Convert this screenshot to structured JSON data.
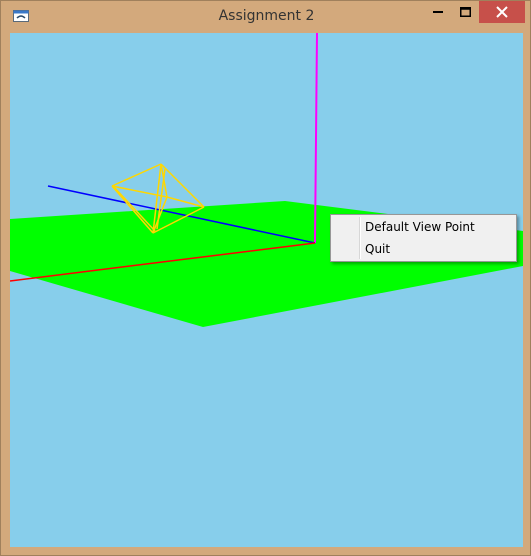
{
  "window": {
    "title": "Assignment 2",
    "controls": {
      "minimize": "minimize",
      "maximize": "maximize",
      "close": "close"
    }
  },
  "context_menu": {
    "items": [
      {
        "label": "Default View Point"
      },
      {
        "label": "Quit"
      }
    ]
  },
  "colors": {
    "sky": "#87ceeb",
    "ground": "#00ff00",
    "x_axis": "#ff0000",
    "y_axis": "#ff00ff",
    "z_axis": "#0000ff",
    "object": "#ffd700",
    "titlebar": "#d3a97c",
    "close_button": "#c7504a"
  },
  "icons": {
    "app": "app-window-icon",
    "minimize": "minimize-icon",
    "maximize": "maximize-icon",
    "close": "close-icon"
  }
}
